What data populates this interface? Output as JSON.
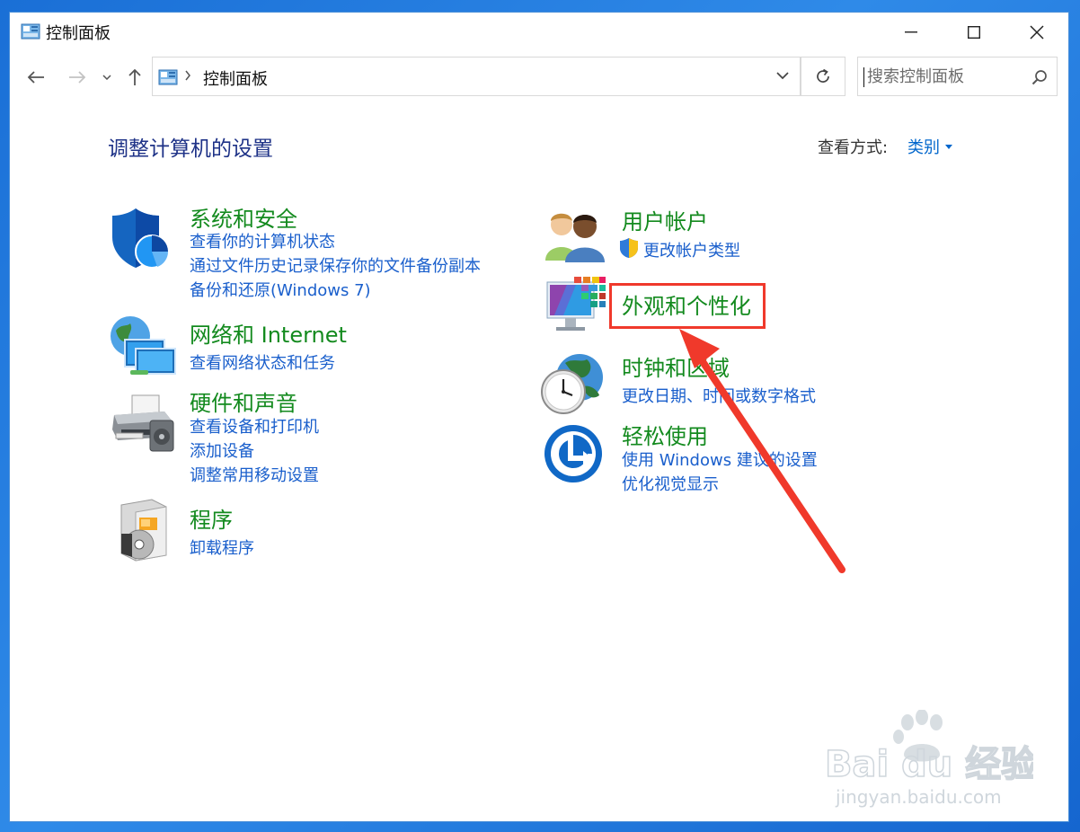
{
  "window": {
    "title": "控制面板",
    "controls": {
      "minimize": "minimize-icon",
      "maximize": "maximize-icon",
      "close": "close-icon"
    }
  },
  "nav": {
    "breadcrumb": "控制面板",
    "search_placeholder": "搜索控制面板"
  },
  "content": {
    "heading": "调整计算机的设置",
    "view_by_label": "查看方式:",
    "view_by_value": "类别"
  },
  "categories": [
    {
      "icon": "shield-icon",
      "title": "系统和安全",
      "links": [
        "查看你的计算机状态",
        "通过文件历史记录保存你的文件备份副本",
        "备份和还原(Windows 7)"
      ]
    },
    {
      "icon": "network-icon",
      "title": "网络和 Internet",
      "links": [
        "查看网络状态和任务"
      ]
    },
    {
      "icon": "printer-icon",
      "title": "硬件和声音",
      "links": [
        "查看设备和打印机",
        "添加设备",
        "调整常用移动设置"
      ]
    },
    {
      "icon": "programs-icon",
      "title": "程序",
      "links": [
        "卸载程序"
      ]
    },
    {
      "icon": "users-icon",
      "title": "用户帐户",
      "links": [
        "更改帐户类型"
      ]
    },
    {
      "icon": "personalization-icon",
      "title": "外观和个性化",
      "links": []
    },
    {
      "icon": "clock-globe-icon",
      "title": "时钟和区域",
      "links": [
        "更改日期、时间或数字格式"
      ]
    },
    {
      "icon": "ease-of-access-icon",
      "title": "轻松使用",
      "links": [
        "使用 Windows 建议的设置",
        "优化视觉显示"
      ]
    }
  ],
  "watermark": {
    "brand": "Bai du 经验",
    "url": "jingyan.baidu.com"
  },
  "colors": {
    "heading": "#1e3287",
    "category_title": "#138a1e",
    "link": "#1a5fcc",
    "annotation": "#f0392b",
    "desktop": "#1a6fd6"
  }
}
